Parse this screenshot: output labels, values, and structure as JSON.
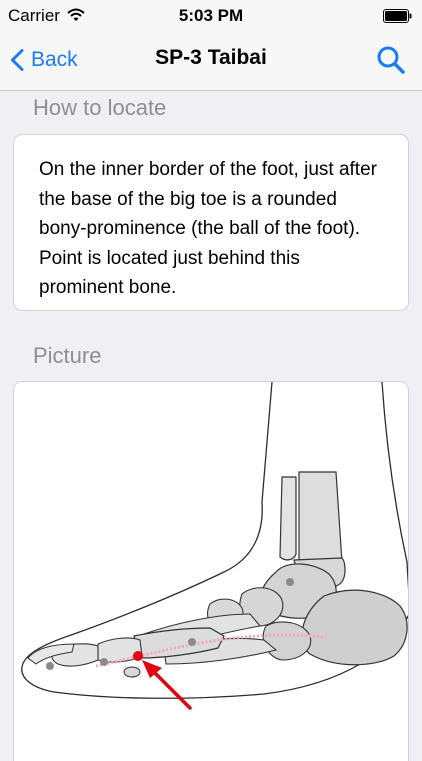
{
  "status_bar": {
    "carrier": "Carrier",
    "time": "5:03 PM"
  },
  "nav": {
    "back_label": "Back",
    "title": "SP-3 Taibai"
  },
  "sections": {
    "how_to_locate": {
      "header": "How to locate",
      "text": "On the inner border of the foot, just after the base of the big toe is a rounded bony-prominence (the ball of the foot). Point is located just behind this prominent bone."
    },
    "picture": {
      "header": "Picture"
    }
  },
  "colors": {
    "accent": "#1a7cf5",
    "acupoint": "#e3000f",
    "meridian": "#f2a6bf",
    "background": "#efeff4"
  },
  "icons": [
    "wifi-icon",
    "battery-icon",
    "back-chevron-icon",
    "search-icon"
  ]
}
